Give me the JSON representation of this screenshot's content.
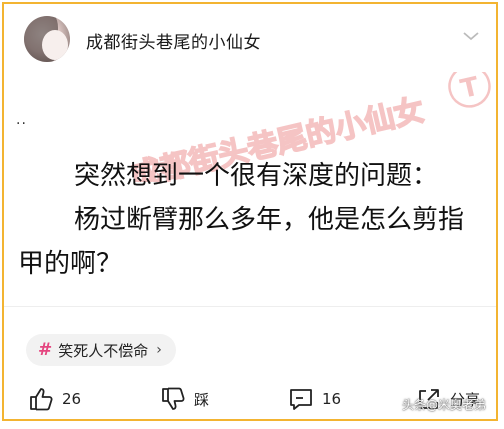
{
  "header": {
    "username": "成都街头巷尾的小仙女"
  },
  "post": {
    "dots": "..",
    "line1": "突然想到一个很有深度的问题：",
    "line2": "杨过断臂那么多年，他是怎么剪指",
    "line3": "甲的啊？",
    "watermark_text": "成都街头巷尾的小仙女",
    "watermark_badge": "T"
  },
  "tag": {
    "hash": "#",
    "label": "笑死人不偿命",
    "arrow": "›"
  },
  "actions": {
    "like_count": "26",
    "dislike_label": "踩",
    "comment_count": "16",
    "share_label": "分享"
  },
  "credit": "头条@米奥老弟",
  "colors": {
    "frame_border": "#f3b431",
    "watermark": "#e35a5a",
    "tag_hash": "#e4457f"
  }
}
